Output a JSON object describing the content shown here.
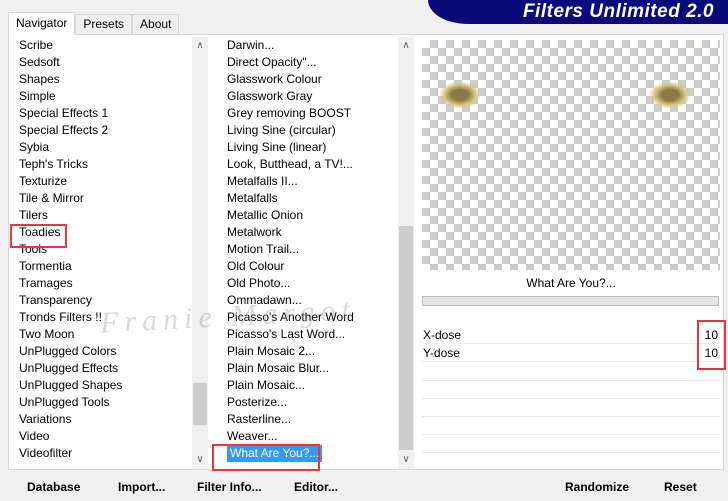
{
  "banner": {
    "title": "Filters Unlimited 2.0",
    "color": "#0a0a7a"
  },
  "tabs": [
    {
      "label": "Navigator",
      "active": true
    },
    {
      "label": "Presets"
    },
    {
      "label": "About"
    }
  ],
  "categories": {
    "items": [
      "Scribe",
      "Sedsoft",
      "Shapes",
      "Simple",
      "Special Effects 1",
      "Special Effects 2",
      "Sybia",
      "Teph's Tricks",
      "Texturize",
      "Tile & Mirror",
      "Tilers",
      "Toadies",
      "Tools",
      "Tormentia",
      "Tramages",
      "Transparency",
      "Tronds Filters !!",
      "Two Moon",
      "UnPlugged Colors",
      "UnPlugged Effects",
      "UnPlugged Shapes",
      "UnPlugged Tools",
      "Variations",
      "Video",
      "Videofilter"
    ],
    "selected": "Toadies"
  },
  "filters": {
    "items": [
      "Darwin...",
      "Direct Opacity\"...",
      "Glasswork Colour",
      "Glasswork Gray",
      "Grey removing BOOST",
      "Living Sine (circular)",
      "Living Sine (linear)",
      "Look, Butthead, a TV!...",
      "Metalfalls II...",
      "Metalfalls",
      "Metallic Onion",
      "Metalwork",
      "Motion Trail...",
      "Old Colour",
      "Old Photo...",
      "Ommadawn...",
      "Picasso's Another Word",
      "Picasso's Last Word...",
      "Plain Mosaic 2...",
      "Plain Mosaic Blur...",
      "Plain Mosaic...",
      "Posterize...",
      "Rasterline...",
      "Weaver...",
      "What Are You?..."
    ],
    "selected": "What Are You?...",
    "selection_color": "#3399ff"
  },
  "preview": {
    "filter_name": "What Are You?..."
  },
  "params": [
    {
      "label": "X-dose",
      "value": "10"
    },
    {
      "label": "Y-dose",
      "value": "10"
    }
  ],
  "buttons": {
    "database": "Database",
    "import": "Import...",
    "filter_info": "Filter Info...",
    "editor": "Editor...",
    "randomize": "Randomize",
    "reset": "Reset"
  },
  "watermark": "Franie Margot",
  "highlight_color": "#e8363b"
}
